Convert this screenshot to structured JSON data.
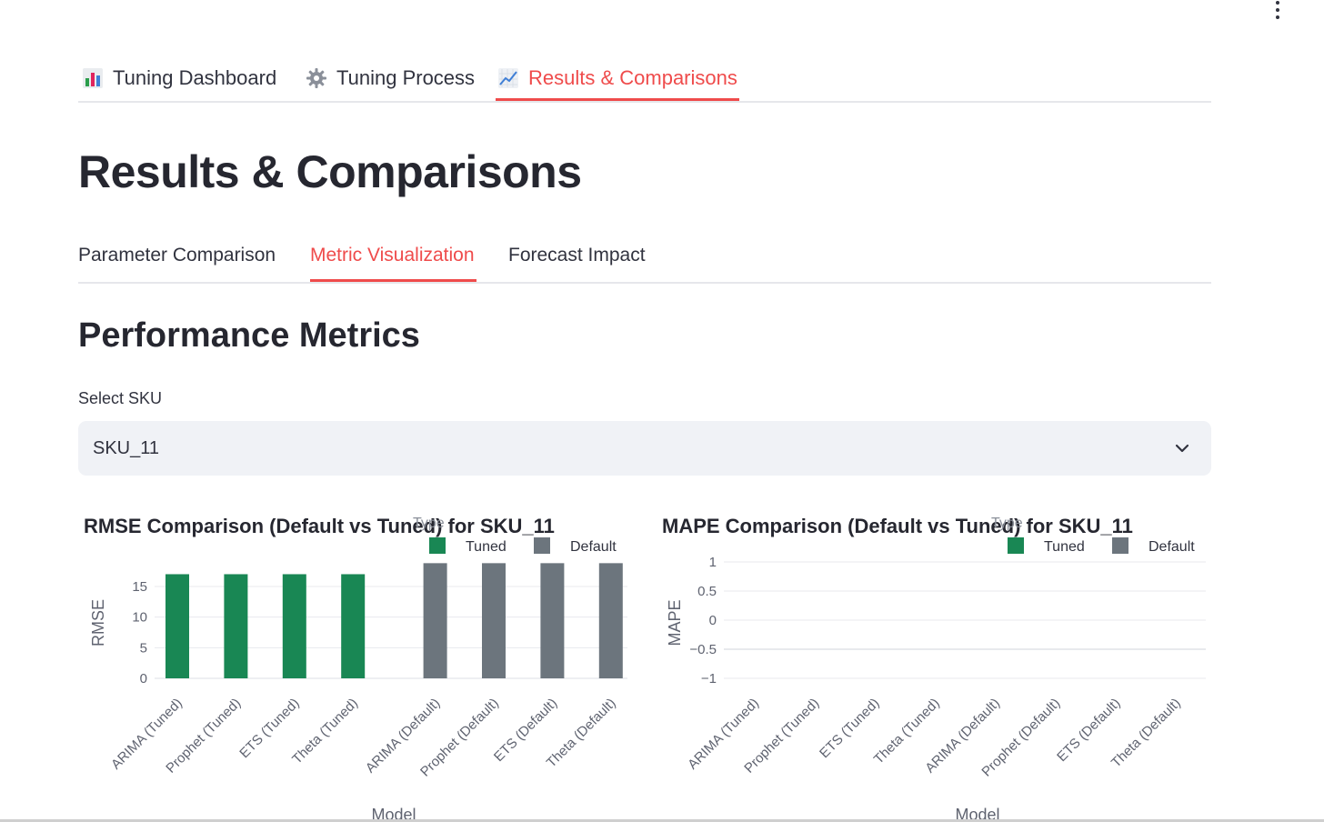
{
  "main_tabs": [
    {
      "label": "Tuning Dashboard",
      "icon": "bar-chart-icon"
    },
    {
      "label": "Tuning Process",
      "icon": "gear-icon"
    },
    {
      "label": "Results & Comparisons",
      "icon": "trend-chart-icon"
    }
  ],
  "page_title": "Results & Comparisons",
  "sub_tabs": [
    {
      "label": "Parameter Comparison"
    },
    {
      "label": "Metric Visualization"
    },
    {
      "label": "Forecast Impact"
    }
  ],
  "section_title": "Performance Metrics",
  "sku_select": {
    "label": "Select SKU",
    "value": "SKU_11"
  },
  "colors": {
    "accent": "#ef4b4b",
    "tuned": "#198754",
    "default": "#6c757d"
  },
  "chart_data": [
    {
      "type": "bar",
      "title": "RMSE Comparison (Default vs Tuned) for SKU_11",
      "legend_title": "Type",
      "legend": [
        "Tuned",
        "Default"
      ],
      "legend_position": "top-right",
      "xlabel": "Model",
      "ylabel": "RMSE",
      "categories": [
        "ARIMA (Tuned)",
        "Prophet (Tuned)",
        "ETS (Tuned)",
        "Theta (Tuned)",
        "ARIMA (Default)",
        "Prophet (Default)",
        "ETS (Default)",
        "Theta (Default)"
      ],
      "series": [
        {
          "name": "Tuned",
          "values": [
            17,
            17,
            17,
            17,
            null,
            null,
            null,
            null
          ]
        },
        {
          "name": "Default",
          "values": [
            null,
            null,
            null,
            null,
            18.8,
            18.8,
            18.8,
            18.8
          ]
        }
      ],
      "yticks": [
        0,
        5,
        10,
        15
      ],
      "ylim": [
        0,
        19
      ],
      "grid": true
    },
    {
      "type": "bar",
      "title": "MAPE Comparison (Default vs Tuned) for SKU_11",
      "legend_title": "Type",
      "legend": [
        "Tuned",
        "Default"
      ],
      "legend_position": "top-right",
      "xlabel": "Model",
      "ylabel": "MAPE",
      "categories": [
        "ARIMA (Tuned)",
        "Prophet (Tuned)",
        "ETS (Tuned)",
        "Theta (Tuned)",
        "ARIMA (Default)",
        "Prophet (Default)",
        "ETS (Default)",
        "Theta (Default)"
      ],
      "series": [
        {
          "name": "Tuned",
          "values": [
            null,
            null,
            null,
            null,
            null,
            null,
            null,
            null
          ]
        },
        {
          "name": "Default",
          "values": [
            null,
            null,
            null,
            null,
            null,
            null,
            null,
            null
          ]
        }
      ],
      "yticks": [
        1,
        0.5,
        0,
        -0.5,
        -1
      ],
      "ytick_labels": [
        "1",
        "0.5",
        "0",
        "−0.5",
        "−1"
      ],
      "ylim": [
        -1,
        1
      ],
      "grid": true
    }
  ]
}
